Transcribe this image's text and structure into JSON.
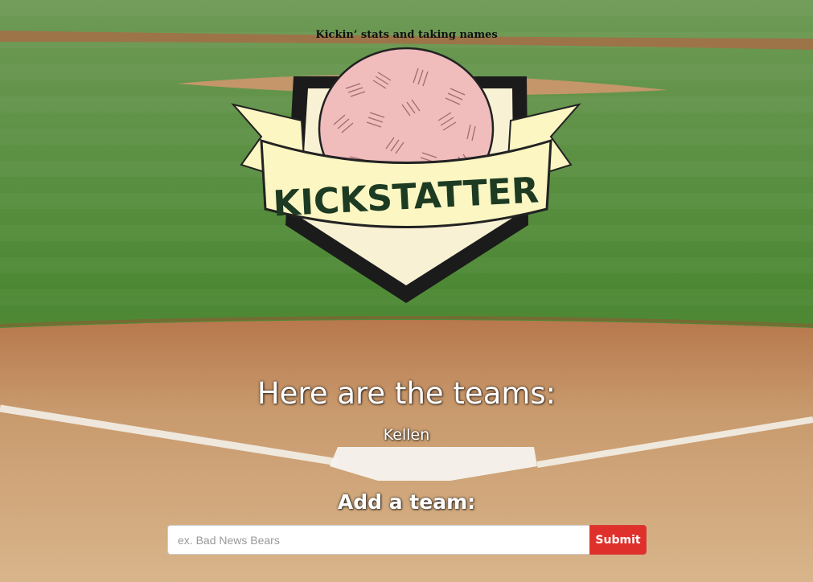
{
  "header": {
    "tagline": "Kickin’ stats and taking names"
  },
  "logo": {
    "wordmark": "KICKSTATTER",
    "ball_color": "#f0bcbc",
    "banner_color": "#fbf6c2"
  },
  "teams": {
    "heading": "Here are the teams:",
    "items": [
      {
        "name": "Kellen"
      }
    ]
  },
  "add_team": {
    "heading": "Add a team:",
    "input_placeholder": "ex. Bad News Bears",
    "input_value": "",
    "submit_label": "Submit"
  },
  "colors": {
    "grass": "#4e8a34",
    "dirt": "#c99a6b",
    "submit": "#e0302b"
  }
}
